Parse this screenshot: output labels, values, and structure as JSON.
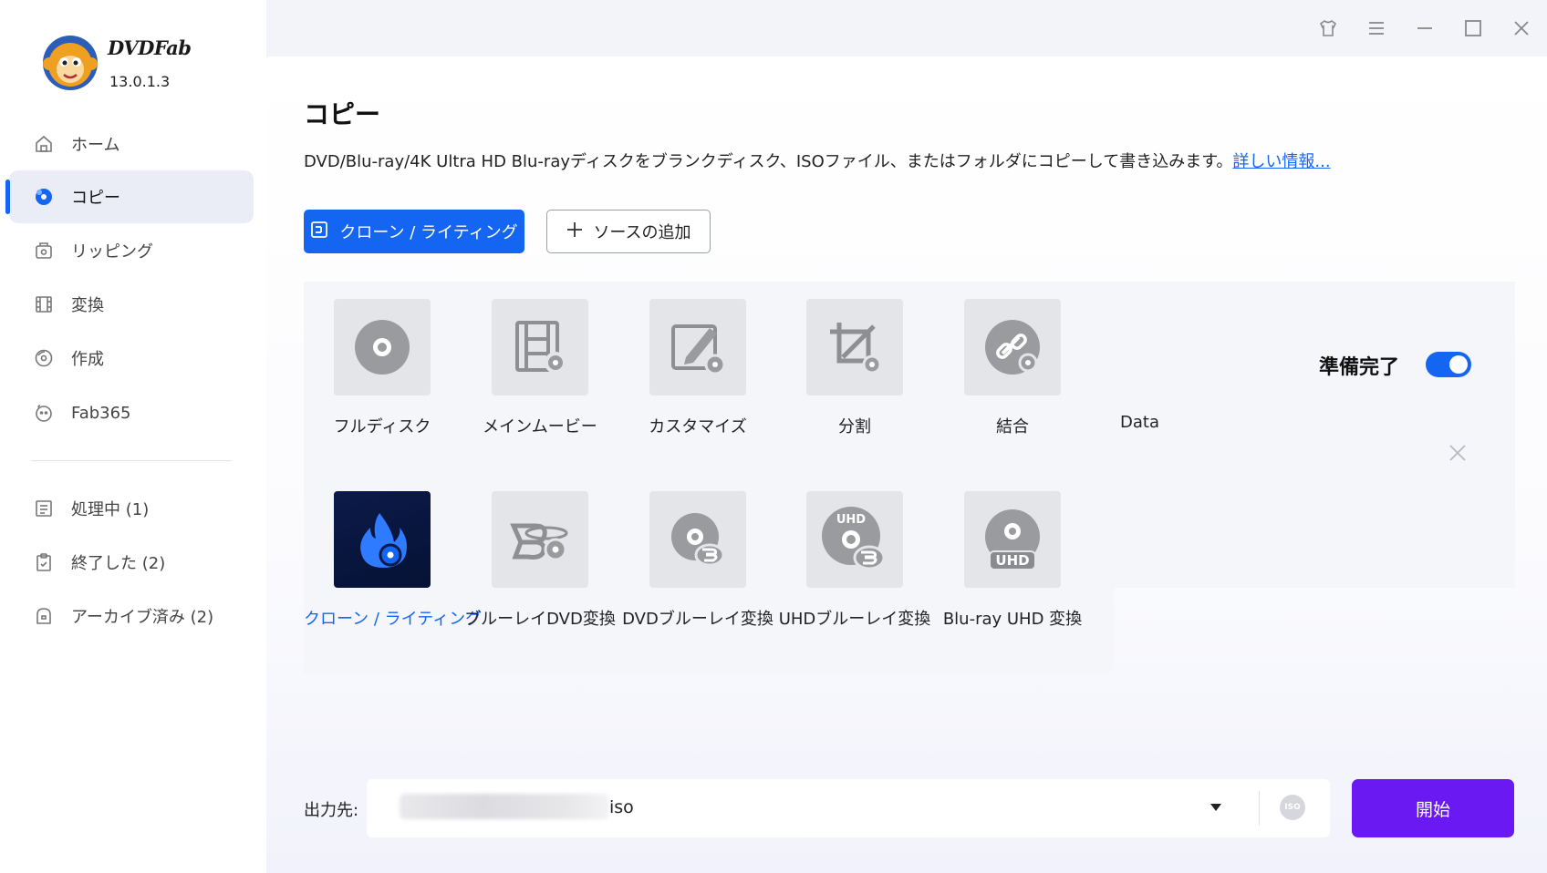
{
  "app": {
    "name": "DVDFab",
    "version": "13.0.1.3"
  },
  "sidebar": {
    "items": [
      {
        "label": "ホーム",
        "icon": "home-icon"
      },
      {
        "label": "コピー",
        "icon": "copy-disc-icon",
        "active": true
      },
      {
        "label": "リッピング",
        "icon": "ripper-icon"
      },
      {
        "label": "変換",
        "icon": "film-icon"
      },
      {
        "label": "作成",
        "icon": "creator-disc-icon"
      },
      {
        "label": "Fab365",
        "icon": "fab365-icon"
      }
    ],
    "tasks": [
      {
        "label": "処理中 (1)",
        "icon": "list-icon"
      },
      {
        "label": "終了した (2)",
        "icon": "clipboard-icon"
      },
      {
        "label": "アーカイブ済み (2)",
        "icon": "archive-icon"
      }
    ]
  },
  "main": {
    "title": "コピー",
    "description": "DVD/Blu-ray/4K Ultra HD Blu-rayディスクをブランクディスク、ISOファイル、またはフォルダにコピーして書き込みます。",
    "more_link": "詳しい情報...",
    "clone_button": "クローン / ライティング",
    "add_source_button": "ソースの追加",
    "modes": [
      {
        "label": "フルディスク",
        "icon": "full-disc-icon"
      },
      {
        "label": "メインムービー",
        "icon": "main-movie-icon"
      },
      {
        "label": "カスタマイズ",
        "icon": "customize-icon"
      },
      {
        "label": "分割",
        "icon": "split-icon"
      },
      {
        "label": "結合",
        "icon": "merge-icon"
      },
      {
        "label": "クローン / ライティング",
        "icon": "clone-burn-icon",
        "selected": true
      },
      {
        "label": "ブルーレイDVD変換",
        "icon": "bluray-to-dvd-icon"
      },
      {
        "label": "DVDブルーレイ変換",
        "icon": "dvd-to-bluray-icon"
      },
      {
        "label": "UHDブルーレイ変換",
        "icon": "uhd-to-bluray-icon"
      },
      {
        "label": "Blu-ray UHD 変換",
        "icon": "bluray-to-uhd-icon"
      }
    ],
    "ready_label": "準備完了",
    "ready_enabled": true,
    "data_label": "Data"
  },
  "output": {
    "label": "出力先:",
    "value": "iso",
    "iso_badge": "ISO",
    "start_button": "開始"
  },
  "colors": {
    "accent": "#1565f3",
    "start": "#6a19f2"
  }
}
